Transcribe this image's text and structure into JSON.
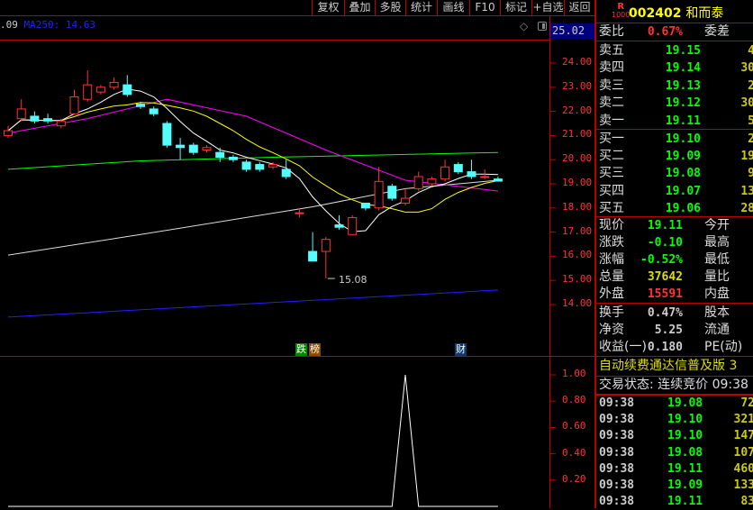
{
  "toolbar": {
    "buttons": [
      "复权",
      "叠加",
      "多股",
      "统计",
      "画线",
      "F10",
      "标记",
      "+自选",
      "返回"
    ]
  },
  "legend": {
    "prev_value": ".09",
    "ma250_label": "MA250: 14.63"
  },
  "axis": {
    "top_price": "25.02",
    "price_ticks": [
      "24.00",
      "23.00",
      "22.00",
      "21.00",
      "20.00",
      "19.00",
      "18.00",
      "17.00",
      "16.00",
      "15.00",
      "14.00"
    ],
    "indicator_ticks": [
      "1.00",
      "0.80",
      "0.60",
      "0.40",
      "0.20"
    ]
  },
  "annotations": {
    "low_label": "15.08",
    "badge_die": "跌",
    "badge_bang": "榜",
    "badge_cai": "财"
  },
  "colors": {
    "up": "#ff3333",
    "down": "#54fcfc",
    "ma5": "#ffffff",
    "ma10": "#ffff00",
    "ma_magenta": "#ff00ff",
    "ma_green": "#00ff00",
    "ma_gray": "#dddddd",
    "ma250": "#2020ff"
  },
  "chart_data": {
    "type": "candlestick",
    "price_range": [
      13.2,
      25.02
    ],
    "candles": [
      [
        21.0,
        21.2,
        21.4,
        20.9
      ],
      [
        21.7,
        22.1,
        22.5,
        21.6
      ],
      [
        21.8,
        21.6,
        22.0,
        21.5
      ],
      [
        21.7,
        21.6,
        21.9,
        21.5
      ],
      [
        21.4,
        21.6,
        21.7,
        21.3
      ],
      [
        21.9,
        22.6,
        22.9,
        21.9
      ],
      [
        22.5,
        23.1,
        23.7,
        22.4
      ],
      [
        22.8,
        23.0,
        23.1,
        22.7
      ],
      [
        23.0,
        23.2,
        23.4,
        22.9
      ],
      [
        23.1,
        22.7,
        23.5,
        22.6
      ],
      [
        22.3,
        22.2,
        22.4,
        22.1
      ],
      [
        22.1,
        21.9,
        22.2,
        21.8
      ],
      [
        21.5,
        20.6,
        21.6,
        20.5
      ],
      [
        20.6,
        20.5,
        20.9,
        20.0
      ],
      [
        20.6,
        20.3,
        20.7,
        20.2
      ],
      [
        20.4,
        20.5,
        20.6,
        20.3
      ],
      [
        20.3,
        20.1,
        20.5,
        19.9
      ],
      [
        20.1,
        20.0,
        20.2,
        19.9
      ],
      [
        19.9,
        19.6,
        20.0,
        19.5
      ],
      [
        19.8,
        19.6,
        19.9,
        19.5
      ],
      [
        19.7,
        19.8,
        19.9,
        19.6
      ],
      [
        19.6,
        19.3,
        20.0,
        19.2
      ],
      [
        17.8,
        17.8,
        18.0,
        17.6
      ],
      [
        16.2,
        15.8,
        17.0,
        15.8
      ],
      [
        16.2,
        16.7,
        16.8,
        15.08
      ],
      [
        17.3,
        17.2,
        17.7,
        17.1
      ],
      [
        16.9,
        17.6,
        17.7,
        16.9
      ],
      [
        18.2,
        18.0,
        18.2,
        17.9
      ],
      [
        18.0,
        19.1,
        19.7,
        17.9
      ],
      [
        18.9,
        18.4,
        19.0,
        18.3
      ],
      [
        18.2,
        18.4,
        18.8,
        18.1
      ],
      [
        18.8,
        19.3,
        19.5,
        18.7
      ],
      [
        19.0,
        19.2,
        19.3,
        18.9
      ],
      [
        19.2,
        19.7,
        20.0,
        19.1
      ],
      [
        19.8,
        19.5,
        19.9,
        19.4
      ],
      [
        19.5,
        19.3,
        20.0,
        19.2
      ],
      [
        19.3,
        19.3,
        19.6,
        19.2
      ],
      [
        19.2,
        19.11,
        19.3,
        19.1
      ]
    ],
    "lines": {
      "magenta": [
        [
          0,
          21.1
        ],
        [
          6,
          21.7
        ],
        [
          12,
          22.5
        ],
        [
          18,
          21.8
        ],
        [
          24,
          20.4
        ],
        [
          30,
          19.15
        ],
        [
          37,
          18.7
        ]
      ],
      "green": [
        [
          0,
          19.6
        ],
        [
          10,
          19.95
        ],
        [
          20,
          20.1
        ],
        [
          37,
          20.3
        ]
      ],
      "gray": [
        [
          0,
          16.05
        ],
        [
          10,
          16.9
        ],
        [
          23,
          18.05
        ],
        [
          30,
          18.8
        ],
        [
          37,
          19.15
        ]
      ],
      "ma250": [
        [
          0,
          13.48
        ],
        [
          37,
          14.6
        ]
      ]
    },
    "indicator": {
      "range": [
        0,
        1.1
      ],
      "values": [
        0,
        0,
        0,
        0,
        0,
        0,
        0,
        0,
        0,
        0,
        0,
        0,
        0,
        0,
        0,
        0,
        0,
        0,
        0,
        0,
        0,
        0,
        0,
        0,
        0,
        0,
        0,
        0,
        0,
        0,
        1,
        0,
        0,
        0,
        0,
        0,
        0,
        0
      ]
    }
  },
  "panel": {
    "stock_code": "002402",
    "stock_name": "和而泰",
    "tag_r": "R",
    "tag_num": "1000",
    "weibi": {
      "label": "委比",
      "value": "0.67%",
      "label2": "委差"
    },
    "sells": [
      {
        "label": "卖五",
        "price": "19.15",
        "vol": "4"
      },
      {
        "label": "卖四",
        "price": "19.14",
        "vol": "30"
      },
      {
        "label": "卖三",
        "price": "19.13",
        "vol": "2"
      },
      {
        "label": "卖二",
        "price": "19.12",
        "vol": "30"
      },
      {
        "label": "卖一",
        "price": "19.11",
        "vol": "5"
      }
    ],
    "buys": [
      {
        "label": "买一",
        "price": "19.10",
        "vol": "2"
      },
      {
        "label": "买二",
        "price": "19.09",
        "vol": "19"
      },
      {
        "label": "买三",
        "price": "19.08",
        "vol": "9"
      },
      {
        "label": "买四",
        "price": "19.07",
        "vol": "13"
      },
      {
        "label": "买五",
        "price": "19.06",
        "vol": "28"
      }
    ],
    "quote": [
      {
        "label": "现价",
        "value": "19.11",
        "label2": "今开",
        "cls": "g"
      },
      {
        "label": "涨跌",
        "value": "-0.10",
        "label2": "最高",
        "cls": "g"
      },
      {
        "label": "涨幅",
        "value": "-0.52%",
        "label2": "最低",
        "cls": "g"
      },
      {
        "label": "总量",
        "value": "37642",
        "label2": "量比",
        "cls": "y"
      },
      {
        "label": "外盘",
        "value": "15591",
        "label2": "内盘",
        "cls": "r"
      }
    ],
    "fin": [
      {
        "label": "换手",
        "value": "0.47%",
        "label2": "股本"
      },
      {
        "label": "净资",
        "value": "5.25",
        "label2": "流通"
      },
      {
        "label": "收益(一)",
        "value": "0.180",
        "label2": "PE(动)"
      }
    ],
    "ad": "自动续费通达信普及版 3",
    "status": "交易状态: 连续竞价 09:38",
    "ticks": [
      {
        "time": "09:38",
        "price": "19.08",
        "vol": "72"
      },
      {
        "time": "09:38",
        "price": "19.10",
        "vol": "321"
      },
      {
        "time": "09:38",
        "price": "19.10",
        "vol": "147"
      },
      {
        "time": "09:38",
        "price": "19.08",
        "vol": "107"
      },
      {
        "time": "09:38",
        "price": "19.11",
        "vol": "460"
      },
      {
        "time": "09:38",
        "price": "19.09",
        "vol": "133"
      },
      {
        "time": "09:38",
        "price": "19.11",
        "vol": "83"
      }
    ]
  }
}
